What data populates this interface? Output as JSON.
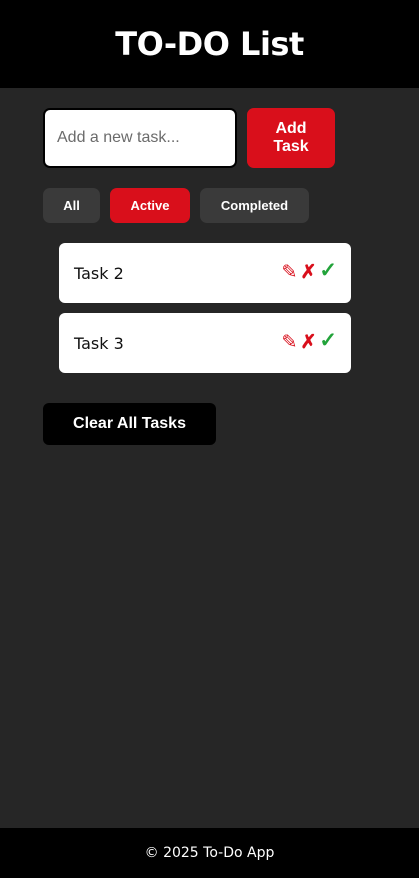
{
  "header": {
    "title": "TO-DO List"
  },
  "input": {
    "placeholder": "Add a new task...",
    "value": ""
  },
  "add_button": {
    "label": "Add Task"
  },
  "filters": [
    {
      "label": "All",
      "active": false
    },
    {
      "label": "Active",
      "active": true
    },
    {
      "label": "Completed",
      "active": false
    }
  ],
  "tasks": [
    {
      "text": "Task 2",
      "icons": {
        "edit": "✎",
        "delete": "✗",
        "complete": "✓"
      }
    },
    {
      "text": "Task 3",
      "icons": {
        "edit": "✎",
        "delete": "✗",
        "complete": "✓"
      }
    }
  ],
  "clear_button": {
    "label": "Clear All Tasks"
  },
  "footer": {
    "text": "© 2025 To-Do App"
  },
  "colors": {
    "accent": "#d90f1b",
    "background": "#262626",
    "header_bg": "#000000",
    "complete_green": "#22a33a",
    "filter_bg": "#3a3a3a"
  }
}
